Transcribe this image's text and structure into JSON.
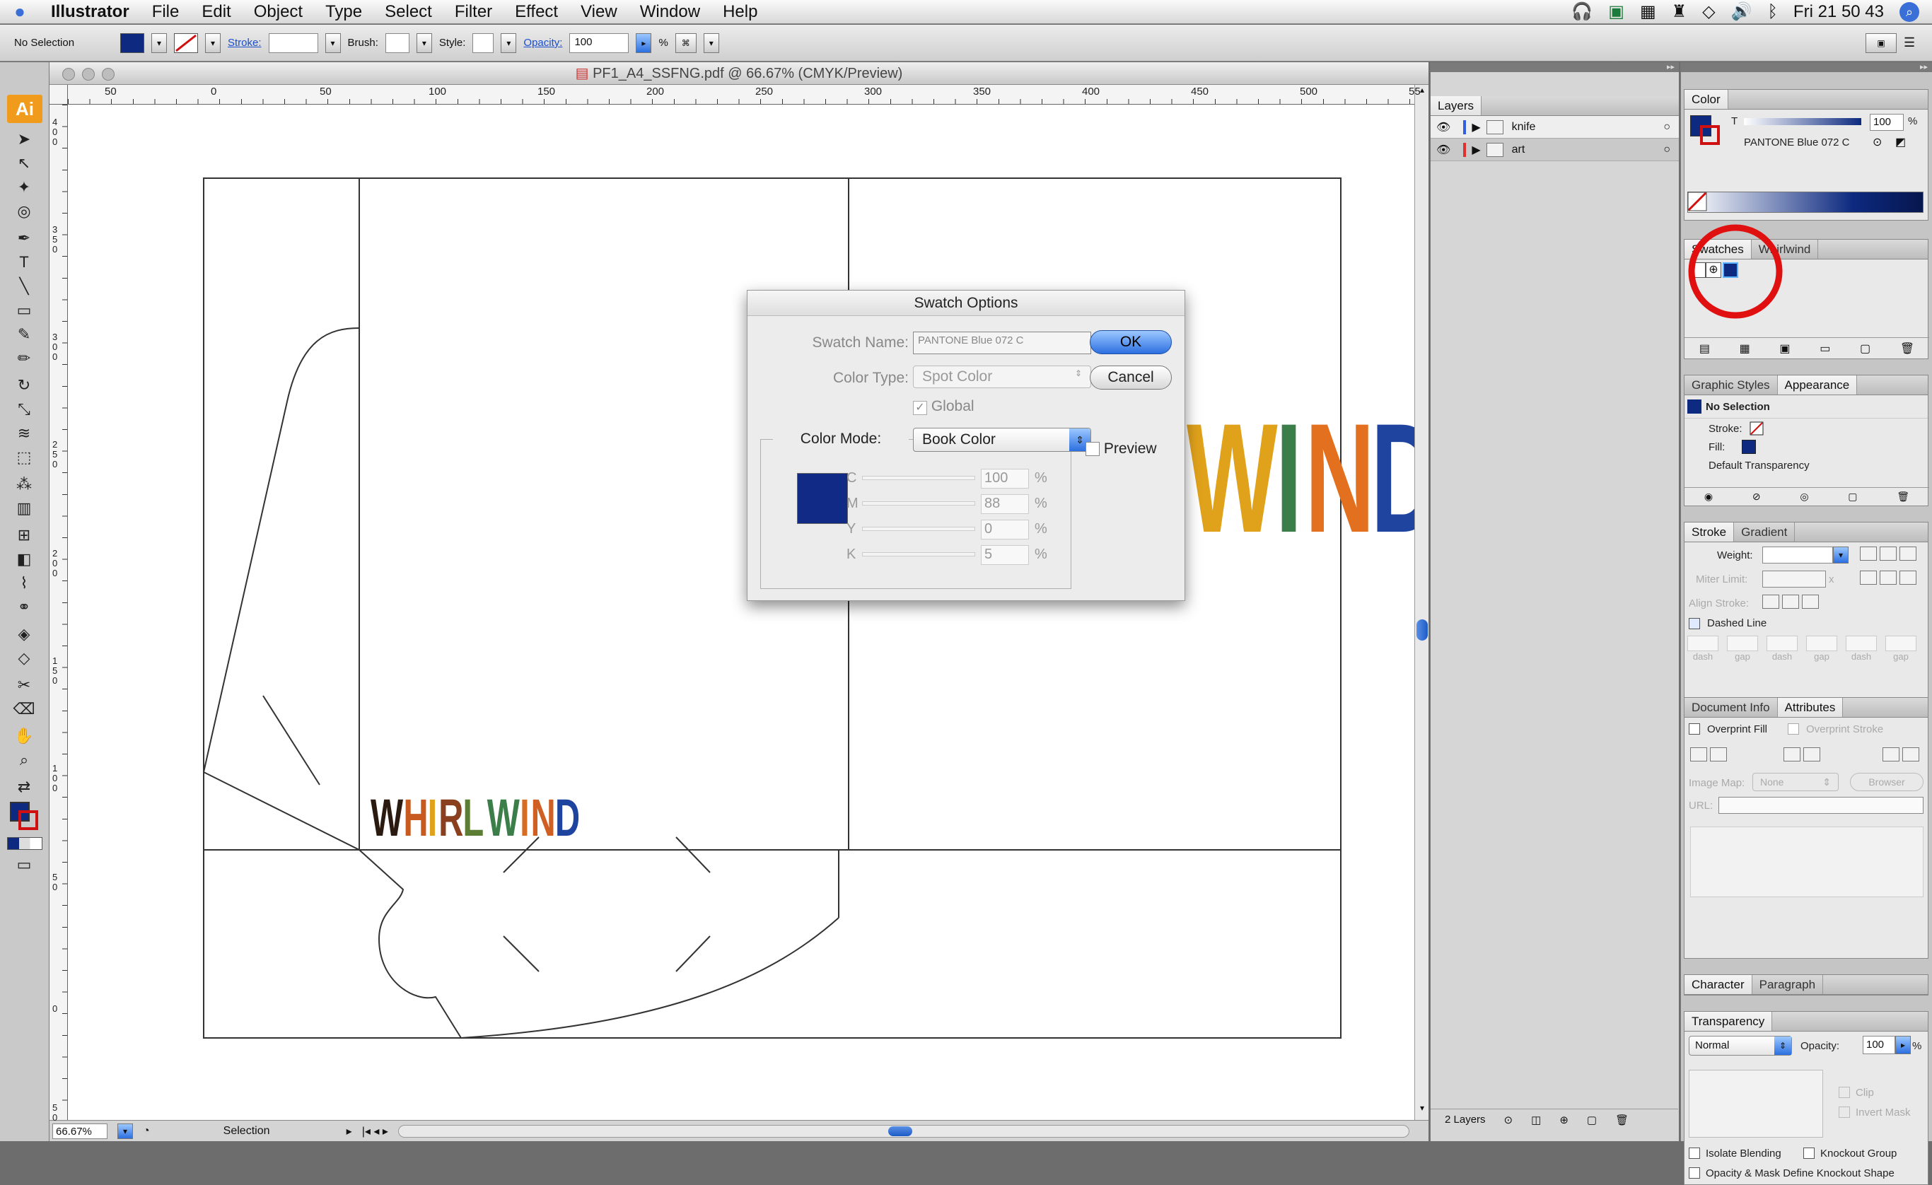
{
  "menubar": {
    "app": "Illustrator",
    "items": [
      "File",
      "Edit",
      "Object",
      "Type",
      "Select",
      "Filter",
      "Effect",
      "View",
      "Window",
      "Help"
    ],
    "clock": "Fri 21 50 43"
  },
  "control": {
    "selection": "No Selection",
    "stroke": "Stroke:",
    "brush": "Brush:",
    "style": "Style:",
    "opacity": "Opacity:",
    "opacity_value": "100",
    "percent": "%"
  },
  "document": {
    "title": "PF1_A4_SSFNG.pdf @ 66.67% (CMYK/Preview)",
    "zoom": "66.67%",
    "status": "Selection",
    "ruler_h": [
      "50",
      "0",
      "50",
      "100",
      "150",
      "200",
      "250",
      "300",
      "350",
      "400",
      "450",
      "500",
      "55"
    ],
    "ruler_v": [
      "4 0 0",
      "3 5 0",
      "3 0 0",
      "2 5 0",
      "2 0 0",
      "1 5 0",
      "1 0 0",
      "5 0",
      "0",
      "5 0"
    ]
  },
  "artwork": {
    "logo": "WHIRLWIND",
    "logo_letters": [
      "W",
      "H",
      "I",
      "R",
      "L",
      "W",
      "I",
      "N",
      "D"
    ],
    "logo_colors": [
      "#2b1a10",
      "#c8591f",
      "#e0a21b",
      "#8a3f1f",
      "#5b7e34",
      "#3c7e4a",
      "#d76c24",
      "#d05f23",
      "#1f44a0"
    ],
    "big_letters": [
      "W",
      "I",
      "N",
      "D"
    ],
    "big_colors": [
      "#e0a21b",
      "#3c7e4a",
      "#e2701f",
      "#1f44a0"
    ]
  },
  "dialog": {
    "title": "Swatch Options",
    "name_label": "Swatch Name:",
    "name_value": "PANTONE Blue 072 C",
    "type_label": "Color Type:",
    "type_value": "Spot Color",
    "global": "Global",
    "mode_label": "Color Mode:",
    "mode_value": "Book Color",
    "preview": "Preview",
    "ok": "OK",
    "cancel": "Cancel",
    "swatch_color": "#102a85",
    "channels": [
      {
        "l": "C",
        "v": "100",
        "p": "%"
      },
      {
        "l": "M",
        "v": "88",
        "p": "%"
      },
      {
        "l": "Y",
        "v": "0",
        "p": "%"
      },
      {
        "l": "K",
        "v": "5",
        "p": "%"
      }
    ]
  },
  "layers": {
    "tab": "Layers",
    "rows": [
      {
        "name": "knife"
      },
      {
        "name": "art"
      }
    ],
    "count": "2 Layers"
  },
  "color_panel": {
    "tab": "Color",
    "value": "100",
    "percent": "%",
    "name": "PANTONE Blue 072 C",
    "tint": "T"
  },
  "swatches": {
    "tab": "Swatches",
    "tab2": "Whirlwind"
  },
  "graphic_styles": {
    "tab": "Graphic Styles",
    "tab2": "Appearance",
    "sel": "No Selection",
    "stroke": "Stroke:",
    "fill": "Fill:",
    "transp": "Default Transparency"
  },
  "stroke_panel": {
    "tab": "Stroke",
    "tab2": "Gradient",
    "weight": "Weight:",
    "miter": "Miter Limit:",
    "x": "x",
    "align": "Align Stroke:",
    "dashed": "Dashed Line",
    "dash_labels": [
      "dash",
      "gap",
      "dash",
      "gap",
      "dash",
      "gap"
    ]
  },
  "doc_info": {
    "tab": "Document Info",
    "tab2": "Attributes",
    "overprint_fill": "Overprint Fill",
    "overprint_stroke": "Overprint Stroke",
    "image_map": "Image Map:",
    "image_map_val": "None",
    "browser": "Browser",
    "url": "URL:"
  },
  "character": {
    "tab": "Character",
    "tab2": "Paragraph"
  },
  "transparency": {
    "tab": "Transparency",
    "mode": "Normal",
    "opacity": "Opacity:",
    "opacity_val": "100",
    "percent": "%",
    "clip": "Clip",
    "invert": "Invert Mask",
    "isolate": "Isolate Blending",
    "knockout": "Knockout Group",
    "opacity_mask": "Opacity & Mask Define Knockout Shape"
  },
  "annotation": {
    "color": "#e01010"
  }
}
